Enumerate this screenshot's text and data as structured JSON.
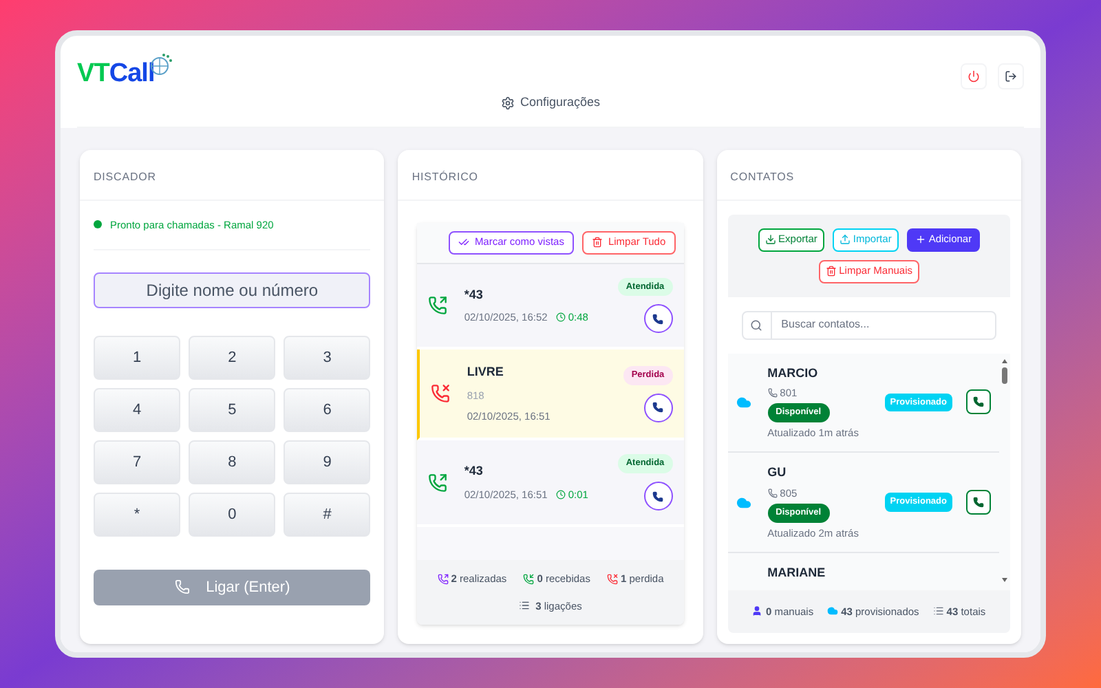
{
  "header": {
    "logo": {
      "part_1": "VT",
      "part_2": "Call"
    },
    "settings_link": "Configurações"
  },
  "dialer": {
    "title": "DISCADOR",
    "status": "Pronto para chamadas - Ramal 920",
    "online": true,
    "input": {
      "placeholder": "Digite nome ou número"
    },
    "keys": [
      "1",
      "2",
      "3",
      "4",
      "5",
      "6",
      "7",
      "8",
      "9",
      "*",
      "0",
      "#"
    ],
    "call_button": {
      "label": "Ligar (Enter)",
      "disabled": true
    }
  },
  "history": {
    "title": "HISTÓRICO",
    "mark_seen_button": "Marcar como vistas",
    "clear_button": "Limpar Tudo",
    "calls": [
      {
        "kind": "outgoing",
        "name": "*43",
        "time": "02/10/2025, 16:52",
        "duration": "0:48",
        "status": "Atendida",
        "highlighted": false
      },
      {
        "kind": "missed",
        "name": "LIVRE",
        "number": "818",
        "time": "02/10/2025, 16:51",
        "status": "Perdida",
        "highlighted": true
      },
      {
        "kind": "outgoing",
        "name": "*43",
        "time": "02/10/2025, 16:51",
        "duration": "0:01",
        "status": "Atendida",
        "highlighted": false
      }
    ],
    "stats": [
      "**2** realizadas",
      "**0** recebidas",
      "**1** perdida"
    ],
    "total": "**3** ligações"
  },
  "contacts": {
    "title": "CONTATOS",
    "export_button": "Exportar",
    "import_button": "Importar",
    "add_button": "Adicionar",
    "clear_button": "Limpar Manuais",
    "search": {
      "placeholder": "Buscar contatos..."
    },
    "items": [
      {
        "name": "MARCIO",
        "extension": "801",
        "status": "Disponível",
        "tag": "Provisionado",
        "updated": "Atualizado 1m atrás"
      },
      {
        "name": "GU",
        "extension": "805",
        "status": "Disponível",
        "tag": "Provisionado",
        "updated": "Atualizado 2m atrás"
      },
      {
        "name": "MARIANE"
      }
    ],
    "footer": [
      "**0** manuais",
      "**43** provisionados",
      "**43** totais"
    ]
  }
}
